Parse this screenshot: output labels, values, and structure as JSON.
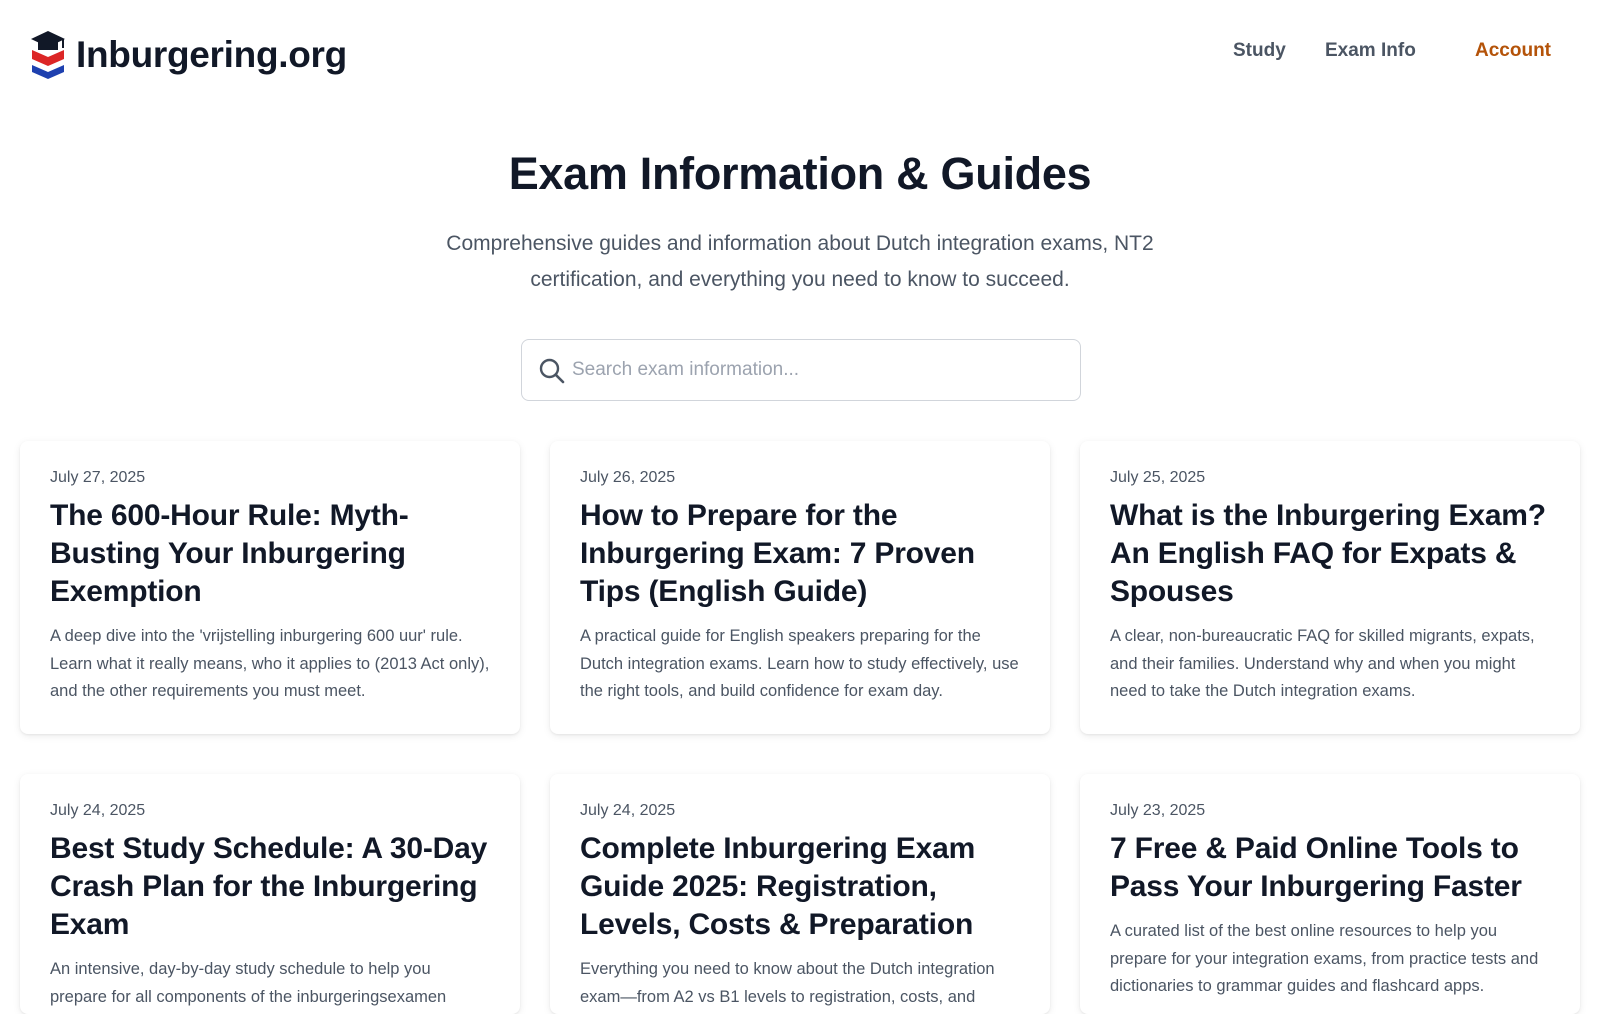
{
  "header": {
    "logo_text": "Inburgering.org",
    "nav": {
      "study": "Study",
      "exam_info": "Exam Info",
      "account": "Account"
    }
  },
  "hero": {
    "title": "Exam Information & Guides",
    "subtitle_line1": "Comprehensive guides and information about Dutch integration exams, NT2",
    "subtitle_line2": "certification, and everything you need to know to succeed."
  },
  "search": {
    "placeholder": "Search exam information..."
  },
  "articles": [
    {
      "date": "July 27, 2025",
      "title": "The 600-Hour Rule: Myth-Busting Your Inburgering Exemption",
      "description": "A deep dive into the 'vrijstelling inburgering 600 uur' rule. Learn what it really means, who it applies to (2013 Act only), and the other requirements you must meet."
    },
    {
      "date": "July 26, 2025",
      "title": "How to Prepare for the Inburgering Exam: 7 Proven Tips (English Guide)",
      "description": "A practical guide for English speakers preparing for the Dutch integration exams. Learn how to study effectively, use the right tools, and build confidence for exam day."
    },
    {
      "date": "July 25, 2025",
      "title": "What is the Inburgering Exam? An English FAQ for Expats & Spouses",
      "description": "A clear, non-bureaucratic FAQ for skilled migrants, expats, and their families. Understand why and when you might need to take the Dutch integration exams."
    },
    {
      "date": "July 24, 2025",
      "title": "Best Study Schedule: A 30-Day Crash Plan for the Inburgering Exam",
      "description": "An intensive, day-by-day study schedule to help you prepare for all components of the inburgeringsexamen"
    },
    {
      "date": "July 24, 2025",
      "title": "Complete Inburgering Exam Guide 2025: Registration, Levels, Costs & Preparation",
      "description": "Everything you need to know about the Dutch integration exam—from A2 vs B1 levels to registration, costs, and"
    },
    {
      "date": "July 23, 2025",
      "title": "7 Free & Paid Online Tools to Pass Your Inburgering Faster",
      "description": "A curated list of the best online resources to help you prepare for your integration exams, from practice tests and dictionaries to grammar guides and flashcard apps."
    }
  ],
  "colors": {
    "accent": "#b45309",
    "text_dark": "#111827",
    "text_muted": "#4b5563",
    "logo_red": "#dc2626",
    "logo_blue": "#1e40af"
  },
  "icons": {
    "logo": "graduation-cap-shield-icon",
    "search": "search-icon"
  }
}
